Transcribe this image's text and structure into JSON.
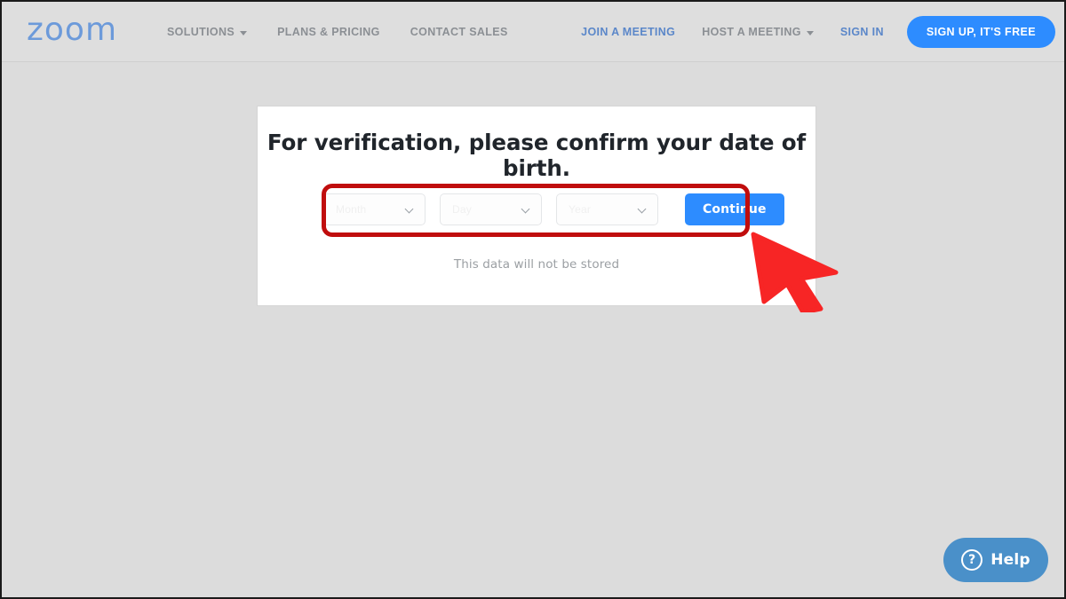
{
  "site": {
    "brand": "zoom",
    "brand_color": "#6c9ada",
    "accent_color": "#2d8cff",
    "highlight_color": "#c00d0d",
    "page_background": "#dcdcdc"
  },
  "navbar": {
    "left_links": [
      {
        "label": "SOLUTIONS",
        "has_caret": true,
        "style": "gray"
      },
      {
        "label": "PLANS & PRICING",
        "has_caret": false,
        "style": "gray"
      },
      {
        "label": "CONTACT SALES",
        "has_caret": false,
        "style": "gray"
      }
    ],
    "right_links": [
      {
        "label": "JOIN A MEETING",
        "has_caret": false,
        "style": "blue"
      },
      {
        "label": "HOST A MEETING",
        "has_caret": true,
        "style": "gray"
      },
      {
        "label": "SIGN IN",
        "has_caret": false,
        "style": "gray"
      }
    ],
    "signup_button": "SIGN UP, IT'S FREE"
  },
  "card": {
    "heading": "For verification, please confirm your date of birth.",
    "disclaimer": "This data will not be stored",
    "selects": [
      {
        "name": "month",
        "value": "Month",
        "placeholder": "Month"
      },
      {
        "name": "day",
        "value": "Day",
        "placeholder": "Day"
      },
      {
        "name": "year",
        "value": "Year",
        "placeholder": "Year"
      }
    ],
    "continue_button": "Continue"
  },
  "help_widget": {
    "label": "Help",
    "icon_glyph": "?"
  },
  "annotations": {
    "highlight_target": "date-of-birth-selectors-and-continue",
    "pointer": "red-arrow-cursor"
  }
}
